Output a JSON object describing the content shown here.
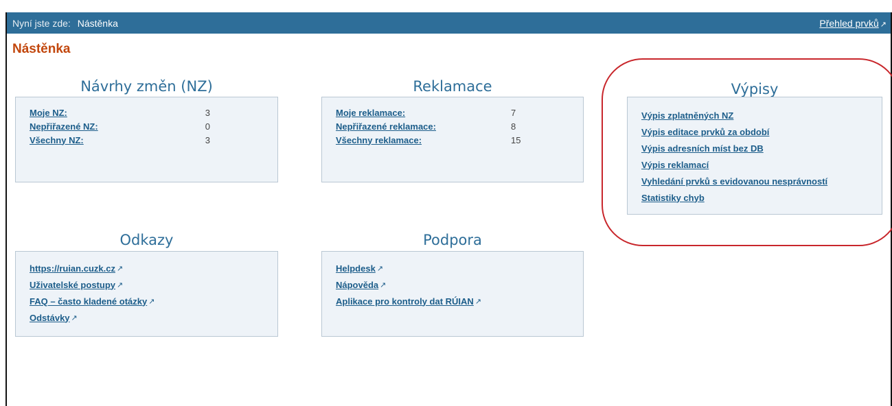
{
  "topbar": {
    "prefix": "Nyní jste zde:",
    "current": "Nástěnka",
    "right_link": "Přehled prvků",
    "ext_icon": "external-link-icon"
  },
  "page": {
    "title": "Nástěnka"
  },
  "sections": {
    "nz": {
      "title": "Návrhy změn (NZ)",
      "rows": [
        {
          "label": "Moje NZ:",
          "value": "3"
        },
        {
          "label": "Nepřiřazené NZ:",
          "value": "0"
        },
        {
          "label": "Všechny NZ:",
          "value": "3"
        }
      ]
    },
    "reklamace": {
      "title": "Reklamace",
      "rows": [
        {
          "label": "Moje reklamace:",
          "value": "7"
        },
        {
          "label": "Nepřiřazené reklamace:",
          "value": "8"
        },
        {
          "label": "Všechny reklamace:",
          "value": "15"
        }
      ]
    },
    "vypisy": {
      "title": "Výpisy",
      "links": [
        "Výpis zplatněných NZ",
        "Výpis editace prvků za období",
        "Výpis adresních míst bez DB",
        "Výpis reklamací",
        "Vyhledání prvků s evidovanou nesprávností",
        "Statistiky chyb"
      ]
    },
    "odkazy": {
      "title": "Odkazy",
      "links": [
        "https://ruian.cuzk.cz",
        "Uživatelské postupy",
        "FAQ – často kladené otázky",
        "Odstávky"
      ]
    },
    "podpora": {
      "title": "Podpora",
      "links": [
        "Helpdesk",
        "Nápověda",
        "Aplikace pro kontroly dat RÚIAN"
      ]
    }
  },
  "colors": {
    "topbar": "#2e6e99",
    "title": "#c2470d",
    "link": "#1c5d8a",
    "panel_bg": "#eef3f8",
    "highlight": "#c8262b"
  }
}
